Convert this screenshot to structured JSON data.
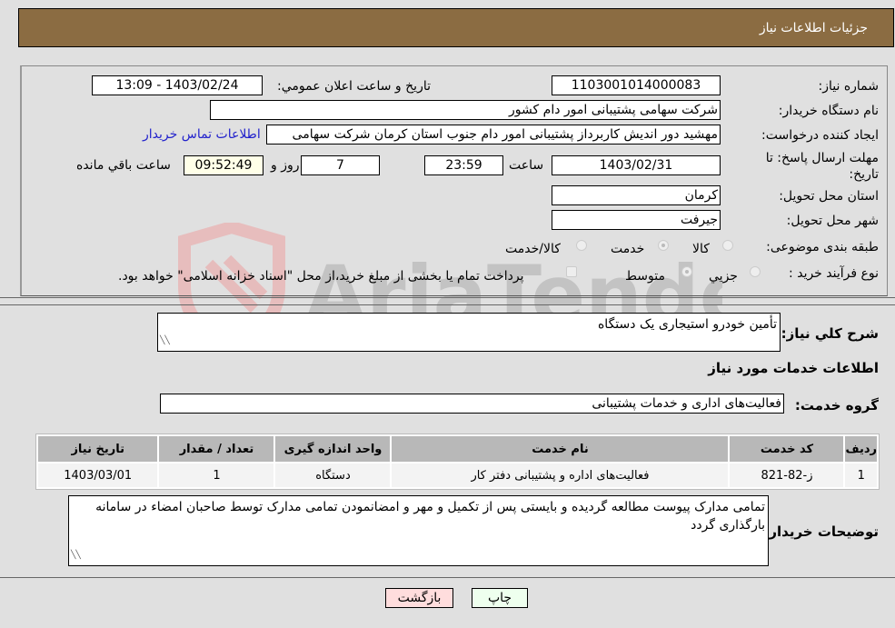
{
  "header": {
    "title": "جزئیات اطلاعات نیاز"
  },
  "fields": {
    "need_number_label": "شماره نیاز:",
    "need_number": "1103001014000083",
    "announce_label": "تاریخ و ساعت اعلان عمومي:",
    "announce_value": "1403/02/24 - 13:09",
    "buyer_org_label": "نام دستگاه خریدار:",
    "buyer_org": "شرکت سهامی پشتیبانی امور دام کشور",
    "creator_label": "ایجاد کننده درخواست:",
    "creator": "مهشید دور اندیش کاربرداز پشتیبانی امور دام جنوب استان کرمان شرکت سهامی",
    "contact_link": "اطلاعات تماس خریدار",
    "deadline_label_line1": "مهلت ارسال پاسخ: تا",
    "deadline_label_line2": "تاریخ:",
    "deadline_date": "1403/02/31",
    "time_label": "ساعت",
    "deadline_time": "23:59",
    "days_value": "7",
    "days_label": "روز و",
    "remaining_time": "09:52:49",
    "remaining_label": "ساعت باقي مانده",
    "province_label": "استان محل تحویل:",
    "province": "کرمان",
    "city_label": "شهر محل تحویل:",
    "city": "جیرفت",
    "category_label": "طبقه بندی موضوعی:",
    "category_options": [
      "کالا",
      "خدمت",
      "کالا/خدمت"
    ],
    "category_selected": "خدمت",
    "process_label": "نوع فرآیند خرید :",
    "process_options": [
      "جزیي",
      "متوسط"
    ],
    "process_selected": "متوسط",
    "treasury_note": "پرداخت تمام یا بخشی از مبلغ خرید،از محل \"اسناد خزانه اسلامی\" خواهد بود."
  },
  "description": {
    "label": "شرح کلي نیاز:",
    "value": "تأمین خودرو استیجاری یک دستگاه"
  },
  "services_section": {
    "title": "اطلاعات خدمات مورد نیاز",
    "group_label": "گروه خدمت:",
    "group_value": "فعالیت‌های اداری و خدمات پشتیبانی"
  },
  "table": {
    "headers": [
      "ردیف",
      "کد خدمت",
      "نام خدمت",
      "واحد اندازه گیری",
      "تعداد / مقدار",
      "تاریخ نیاز"
    ],
    "rows": [
      [
        "1",
        "ز-82-821",
        "فعالیت‌های اداره و پشتیبانی دفتر کار",
        "دستگاه",
        "1",
        "1403/03/01"
      ]
    ]
  },
  "buyer_notes": {
    "label": "توضیحات خریدار:",
    "value": "تمامی مدارک پیوست مطالعه گردیده و بایستی پس از تکمیل و مهر و امضانمودن تمامی مدارک توسط صاحبان امضاء در سامانه بارگذاری گردد"
  },
  "buttons": {
    "print": "چاپ",
    "back": "بازگشت"
  },
  "watermark": {
    "text": "AriaTender.neT"
  },
  "colors": {
    "header_bg": "#8b6c42",
    "print_bg": "#eeffee",
    "back_bg": "#ffdddd",
    "link": "#2222cc"
  }
}
